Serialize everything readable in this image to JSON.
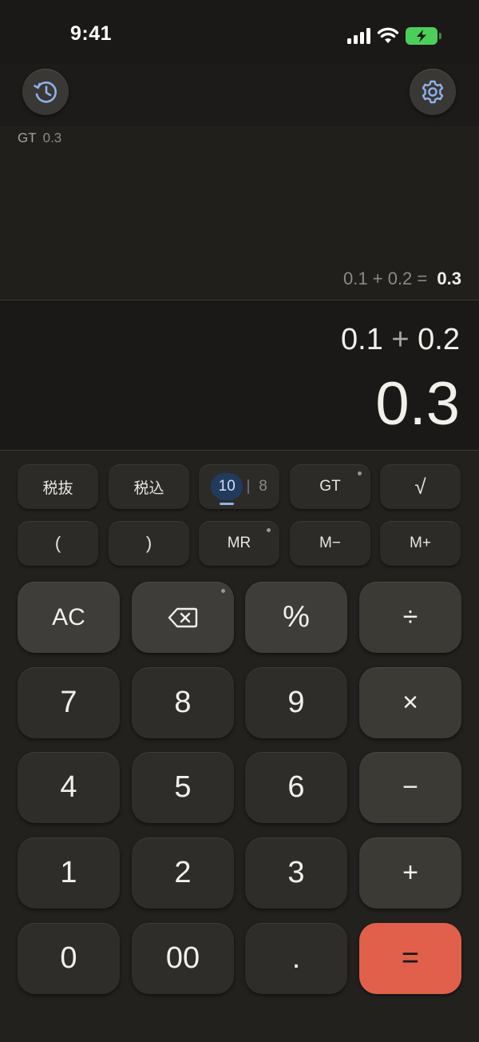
{
  "status": {
    "time": "9:41"
  },
  "history": {
    "gt_label": "GT",
    "gt_value": "0.3",
    "entry_lhs": "0.1",
    "entry_op": "+",
    "entry_rhs": "0.2",
    "entry_eq": "=",
    "entry_result": "0.3"
  },
  "display": {
    "lhs": "0.1",
    "op": "+",
    "rhs": "0.2",
    "result": "0.3"
  },
  "keys": {
    "tax_excluded": "税抜",
    "tax_included": "税込",
    "base_10": "10",
    "base_8": "8",
    "gt": "GT",
    "sqrt": "√",
    "paren_open": "(",
    "paren_close": ")",
    "mr": "MR",
    "m_minus": "M−",
    "m_plus": "M+",
    "ac": "AC",
    "percent": "%",
    "divide": "÷",
    "seven": "7",
    "eight": "8",
    "nine": "9",
    "multiply": "×",
    "four": "4",
    "five": "5",
    "six": "6",
    "minus": "−",
    "one": "1",
    "two": "2",
    "three": "3",
    "plus": "+",
    "zero": "0",
    "double_zero": "00",
    "decimal": ".",
    "equals": "="
  },
  "colors": {
    "accent": "#e0604b",
    "base_toggle": "#223a5c",
    "icon_blue": "#8fb2ea",
    "battery": "#4ccf5a"
  },
  "icons": {
    "history": "history-icon",
    "settings": "gear-icon",
    "backspace": "backspace-icon"
  }
}
